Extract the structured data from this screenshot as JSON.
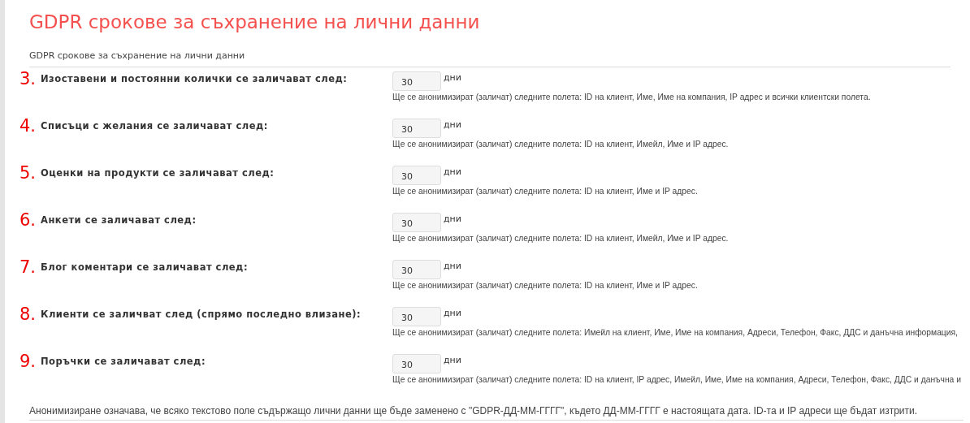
{
  "title": "GDPR срокове за съхранение на лични данни",
  "section_title": "GDPR срокове за съхранение на лични данни",
  "settings": [
    {
      "number": "3.",
      "label": "Изоставени и постоянни колички се заличават след:",
      "value": "30",
      "unit": "дни",
      "hint": "Ще се анонимизират (заличат) следните полета: ID на клиент, Име, Име на компания, IP адрес и всички клиентски полета."
    },
    {
      "number": "4.",
      "label": "Списъци с желания се заличават след:",
      "value": "30",
      "unit": "дни",
      "hint": "Ще се анонимизират (заличат) следните полета: ID на клиент, Имейл, Име и IP адрес."
    },
    {
      "number": "5.",
      "label": "Оценки на продукти се заличават след:",
      "value": "30",
      "unit": "дни",
      "hint": "Ще се анонимизират (заличат) следните полета: ID на клиент, Име и IP адрес."
    },
    {
      "number": "6.",
      "label": "Анкети се заличават след:",
      "value": "30",
      "unit": "дни",
      "hint": "Ще се анонимизират (заличат) следните полета: ID на клиент, Имейл, Име и IP адрес."
    },
    {
      "number": "7.",
      "label": "Блог коментари се заличават след:",
      "value": "30",
      "unit": "дни",
      "hint": "Ще се анонимизират (заличат) следните полета: ID на клиент, Име и IP адрес."
    },
    {
      "number": "8.",
      "label": "Клиенти се заличват след (спрямо последно влизане):",
      "value": "30",
      "unit": "дни",
      "hint": "Ще се анонимизират (заличат) следните полета: Имейл на клиент, Име, Име на компания, Адреси, Телефон, Факс, ДДС и данъчна информация,"
    },
    {
      "number": "9.",
      "label": "Поръчки се заличават след:",
      "value": "30",
      "unit": "дни",
      "hint": "Ще се анонимизират (заличат) следните полета: ID на клиент, IP адрес, Имейл, Име, Име на компания, Адреси, Телефон, Факс, ДДС и данъчна и"
    }
  ],
  "footer_note": "Анонимизиране означава, че всяко текстово поле съдържащо лични данни ще бъде заменено с \"GDPR-ДД-ММ-ГГГГ\", където ДД-ММ-ГГГГ е настоящата дата. ID-та и IP адреси ще бъдат изтрити."
}
